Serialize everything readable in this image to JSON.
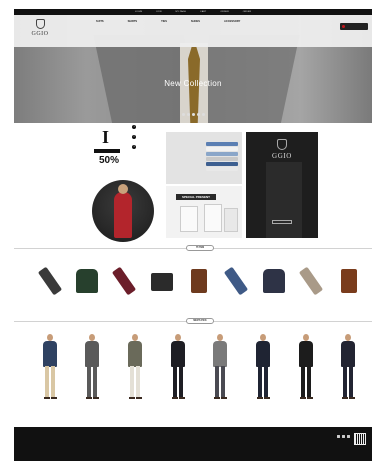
{
  "topbar": {
    "links": [
      "LOGIN",
      "JOIN",
      "MY PAGE",
      "CART",
      "ORDER",
      "ORDER"
    ]
  },
  "header": {
    "logo_text": "GGIO",
    "logo_tagline": "",
    "nav": [
      {
        "title": "SUITS",
        "items": [
          "",
          "",
          ""
        ]
      },
      {
        "title": "SHIRTS",
        "items": [
          "",
          "",
          "",
          ""
        ]
      },
      {
        "title": "TIES",
        "items": [
          "",
          "",
          ""
        ]
      },
      {
        "title": "SHOES",
        "items": [
          "",
          ""
        ]
      },
      {
        "title": "ACCESSORY",
        "items": [
          "",
          "",
          "",
          ""
        ]
      }
    ],
    "right_links": [
      "",
      "",
      "",
      "",
      "",
      ""
    ],
    "cart_label": ""
  },
  "hero": {
    "text": "New Collection",
    "dots": 5
  },
  "promo": {
    "sale_letter": "I",
    "sale_percent": "50%",
    "sale_percent_label": "",
    "sale_list": [
      {
        "num": "1",
        "text": ""
      },
      {
        "num": "2",
        "text": ""
      },
      {
        "num": "3",
        "text": ""
      }
    ],
    "circle_text": "",
    "shirts_title": "",
    "shirts_sub": "",
    "present_label": "",
    "present_title": "SPECIAL PRESENT",
    "dark_logo": "GGIO",
    "dark_headline": "",
    "dark_sub": ""
  },
  "sections": {
    "items_title": "IT ITEM",
    "looks_title": "MEN'S PICK"
  },
  "items": [
    {
      "name": "",
      "price": "",
      "kind": "tie",
      "color": "#3a3a3a"
    },
    {
      "name": "",
      "price": "",
      "kind": "sweater",
      "color": "#27402d"
    },
    {
      "name": "",
      "price": "",
      "kind": "tie",
      "color": "#6b1e2a"
    },
    {
      "name": "",
      "price": "",
      "kind": "bag",
      "color": "#2b2b2b"
    },
    {
      "name": "",
      "price": "",
      "kind": "tote",
      "color": "#6e3a1e"
    },
    {
      "name": "",
      "price": "",
      "kind": "tie",
      "color": "#3f5a86"
    },
    {
      "name": "",
      "price": "",
      "kind": "sweater",
      "color": "#2e3346"
    },
    {
      "name": "",
      "price": "",
      "kind": "tie",
      "color": "#a99a88"
    },
    {
      "name": "",
      "price": "",
      "kind": "tote",
      "color": "#7a3c1c"
    }
  ],
  "looks": [
    {
      "name": "",
      "price": "",
      "top": "#2f4262",
      "pants": "#d9c7a4"
    },
    {
      "name": "",
      "price": "",
      "top": "#5a5a5a",
      "pants": "#5a5a5a"
    },
    {
      "name": "",
      "price": "",
      "top": "#6a6a5a",
      "pants": "#e4e0d6"
    },
    {
      "name": "",
      "price": "",
      "top": "#1e1e24",
      "pants": "#1e1e24"
    },
    {
      "name": "",
      "price": "",
      "top": "#7a7a7a",
      "pants": "#4a4a52"
    },
    {
      "name": "",
      "price": "",
      "top": "#1f2433",
      "pants": "#1f2433"
    },
    {
      "name": "",
      "price": "",
      "top": "#1c1c1c",
      "pants": "#1c1c1c"
    },
    {
      "name": "",
      "price": "",
      "top": "#222432",
      "pants": "#222432"
    }
  ],
  "footer": {
    "links": [
      "",
      "",
      "",
      "",
      ""
    ],
    "info": [
      "",
      "",
      "",
      ""
    ]
  },
  "colors": {
    "accent_red": "#c4161c",
    "dark": "#111111"
  }
}
